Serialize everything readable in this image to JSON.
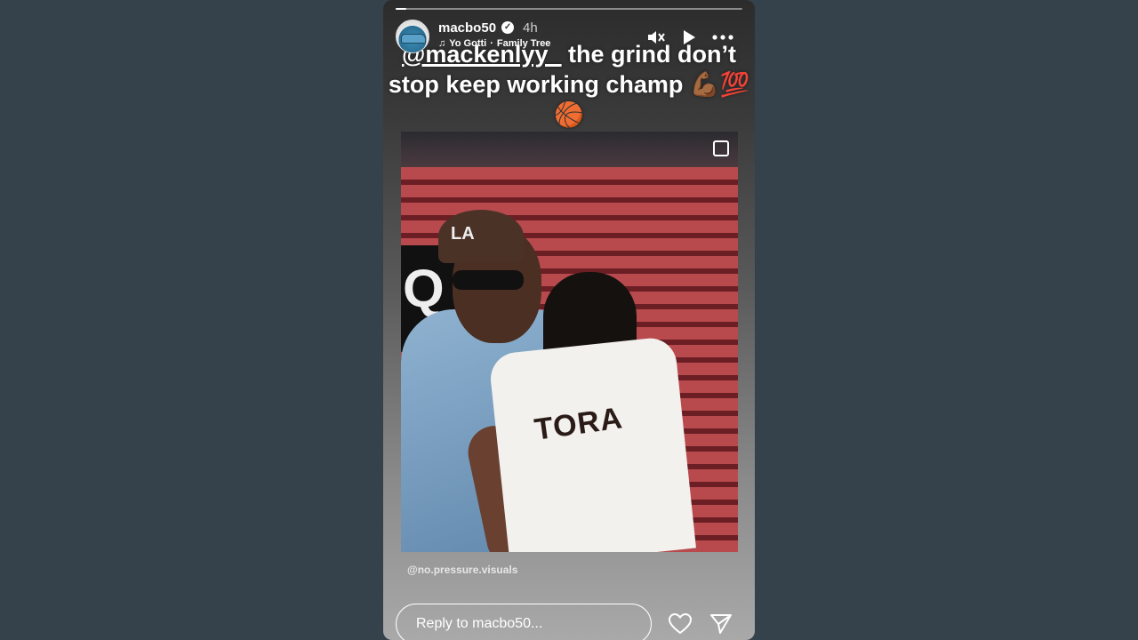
{
  "story": {
    "username": "macbo50",
    "verified_icon": "verified-badge-icon",
    "time_ago": "4h",
    "music": {
      "note_icon": "music-note-icon",
      "artist": "Yo Gotti",
      "separator": "·",
      "track": "Family Tree"
    },
    "progress_fraction": 0.03,
    "controls": [
      "mute-icon",
      "play-icon",
      "more-icon"
    ]
  },
  "caption": {
    "mention": "@mackenlyy_",
    "text_rest": " the grind don’t stop keep working champ 💪🏾💯🏀"
  },
  "photo": {
    "jersey_text": "TORA"
  },
  "credit": "@no.pressure.visuals",
  "reply": {
    "placeholder": "Reply to macbo50...",
    "like_icon": "heart-icon",
    "send_icon": "send-icon"
  }
}
